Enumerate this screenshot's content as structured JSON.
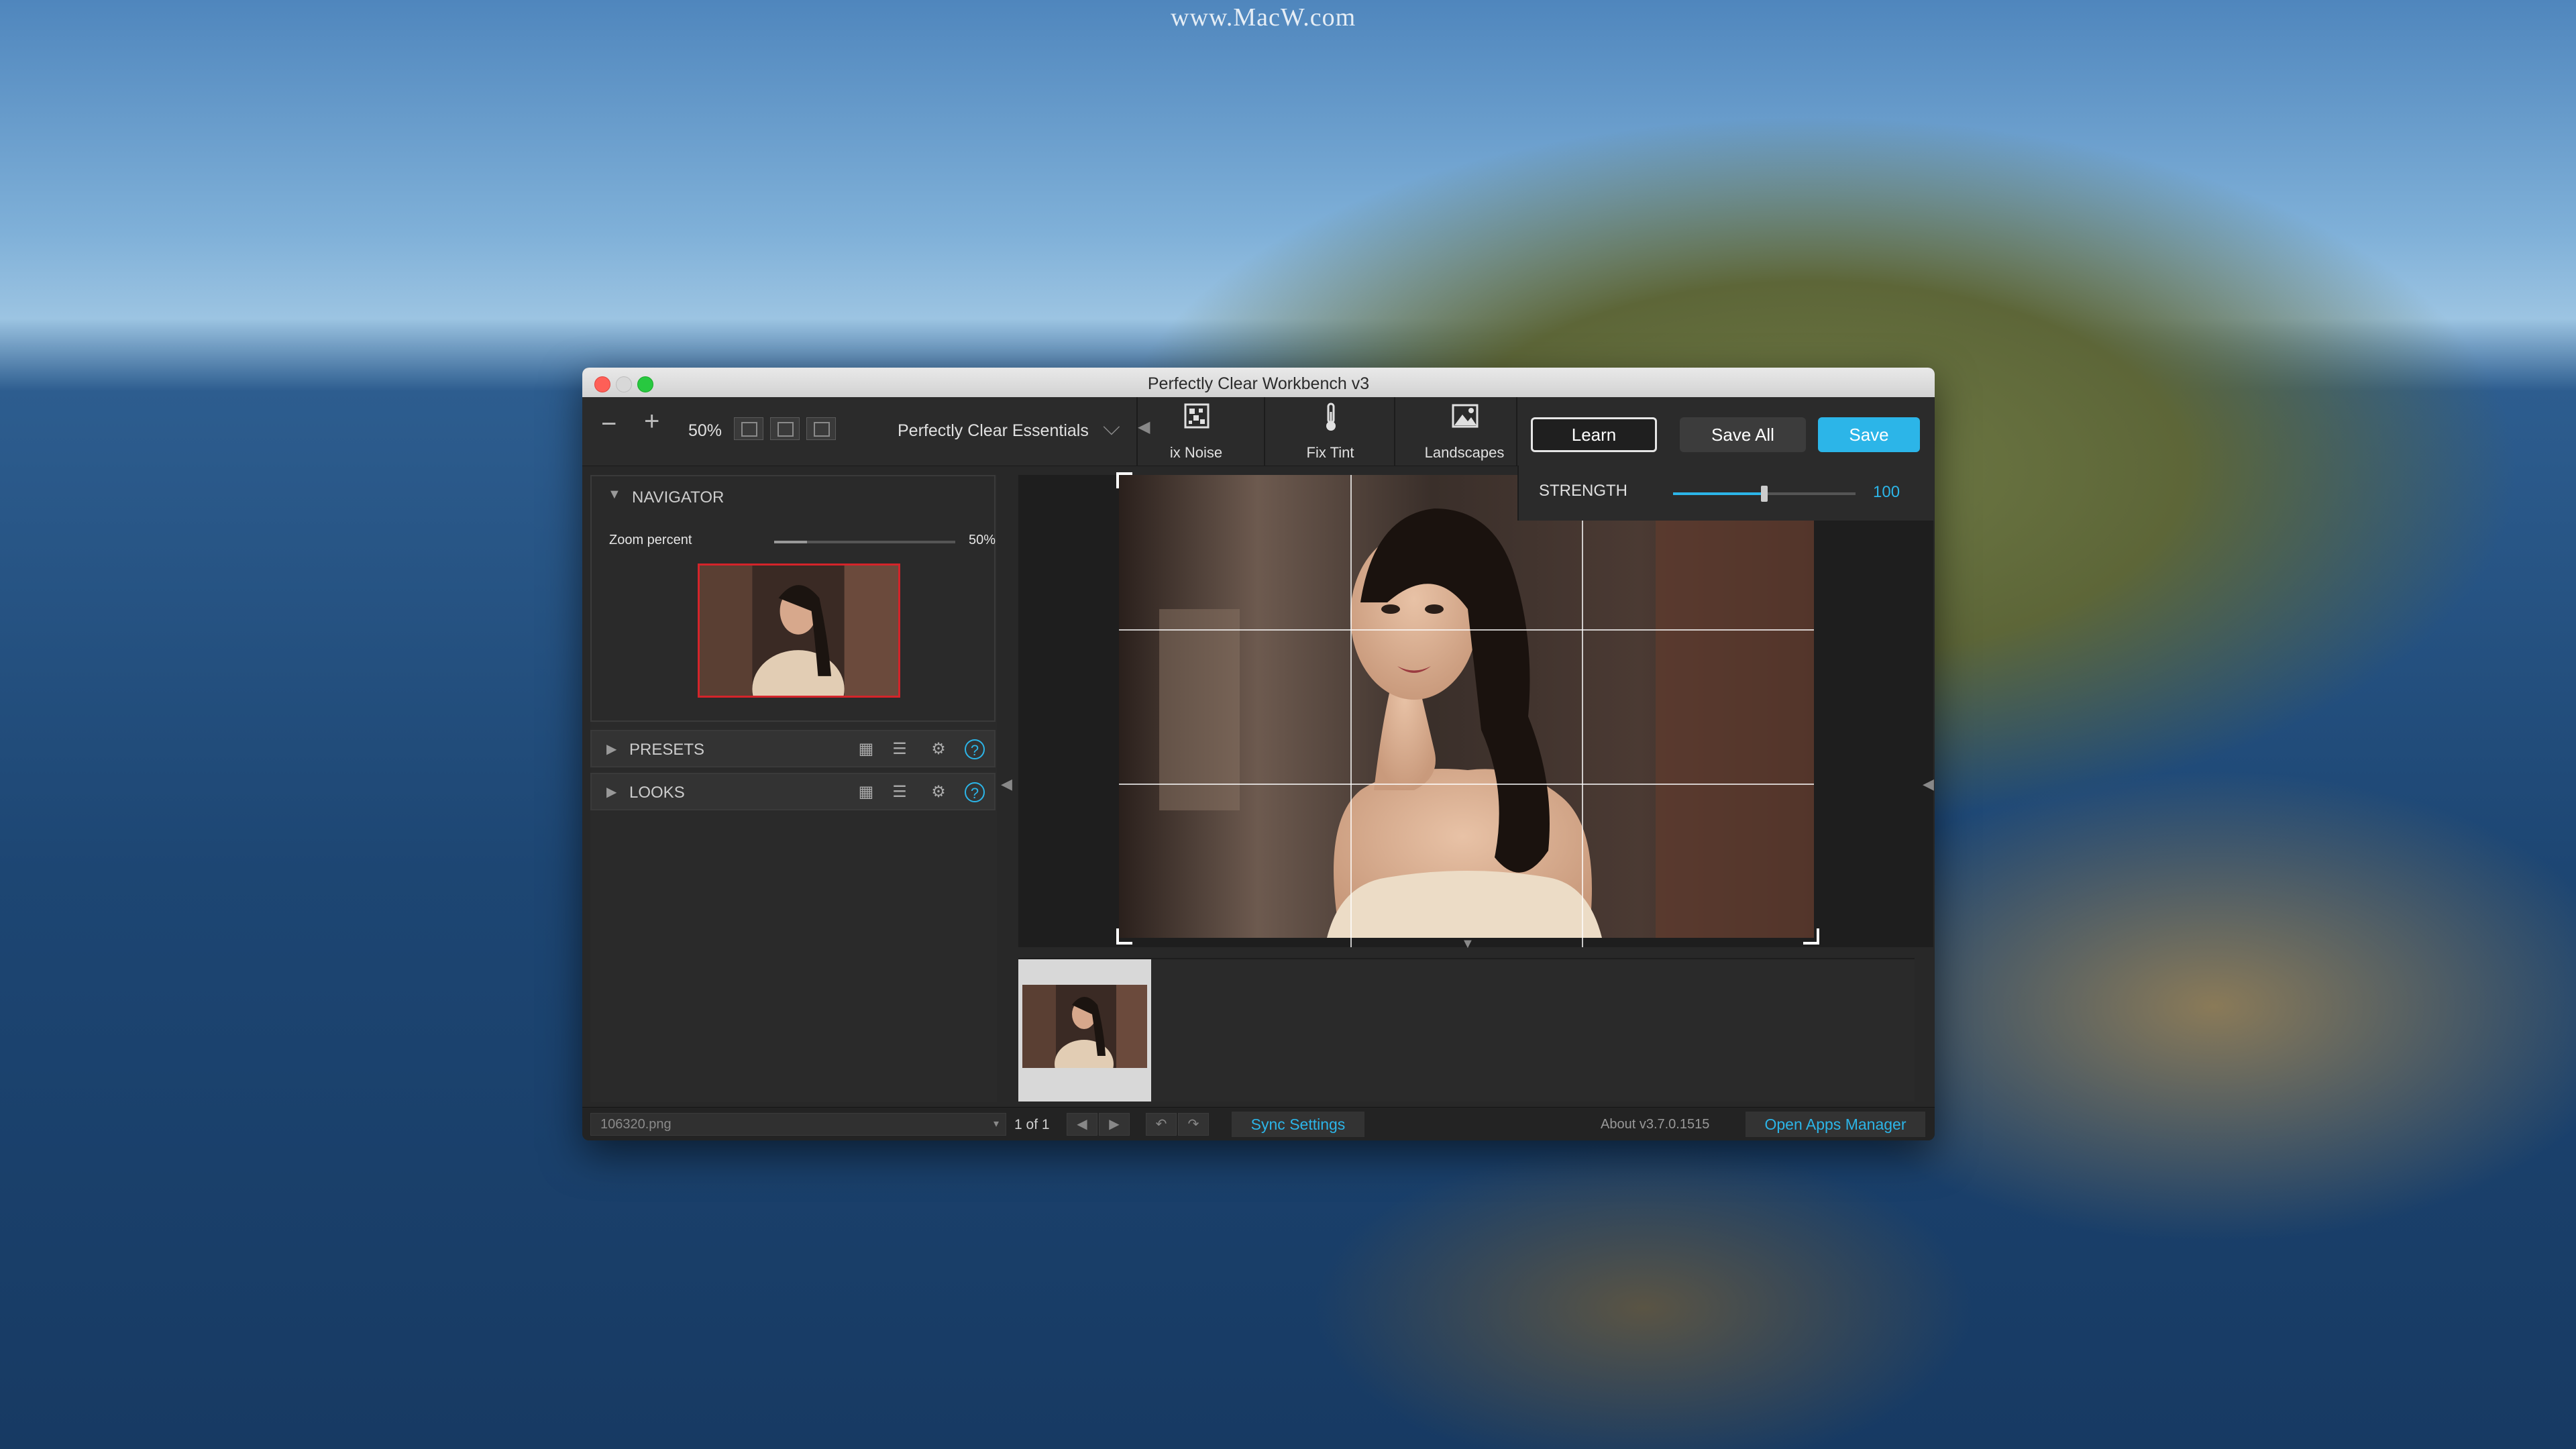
{
  "watermark": "www.MacW.com",
  "window": {
    "title": "Perfectly Clear Workbench v3"
  },
  "toolbar": {
    "zoom_out_icon": "−",
    "zoom_in_icon": "+",
    "zoom_value": "50%",
    "preset_name": "Perfectly Clear Essentials",
    "preset_chevron": "⌵",
    "tools": [
      {
        "label": "ix Noise",
        "icon": "fix-noise-icon"
      },
      {
        "label": "Fix Tint",
        "icon": "thermometer-icon"
      },
      {
        "label": "Landscapes",
        "icon": "landscape-icon"
      }
    ],
    "learn_label": "Learn",
    "save_all_label": "Save All",
    "save_label": "Save"
  },
  "strength": {
    "label": "STRENGTH",
    "value": "100",
    "fraction": 0.5
  },
  "navigator": {
    "title": "NAVIGATOR",
    "zoom_label": "Zoom percent",
    "zoom_value": "50%",
    "zoom_fraction": 0.18
  },
  "presets": {
    "title": "PRESETS"
  },
  "looks": {
    "title": "LOOKS"
  },
  "status": {
    "filename": "106320.png",
    "page_count": "1 of 1",
    "sync_label": "Sync Settings",
    "about": "About v3.7.0.1515",
    "apps_manager_label": "Open Apps Manager"
  },
  "colors": {
    "accent": "#2cb5e8",
    "nav_frame": "#d4242a",
    "window_bg": "#282828"
  }
}
